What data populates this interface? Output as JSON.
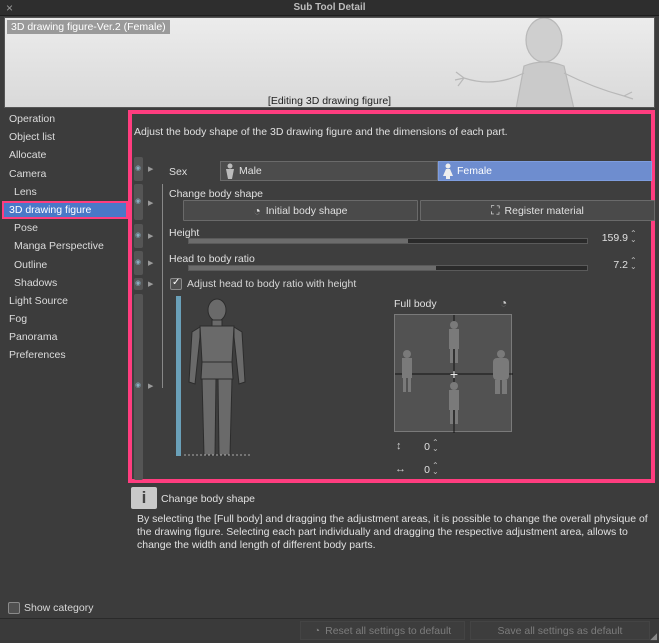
{
  "window": {
    "title": "Sub Tool Detail",
    "close_icon": "×"
  },
  "preview": {
    "tool_name": "3D drawing figure-Ver.2 (Female)",
    "status": "[Editing 3D drawing figure]"
  },
  "sidebar": {
    "items": [
      {
        "label": "Operation",
        "sub": false
      },
      {
        "label": "Object list",
        "sub": false
      },
      {
        "label": "Allocate",
        "sub": false
      },
      {
        "label": "Camera",
        "sub": false
      },
      {
        "label": "Lens",
        "sub": true
      },
      {
        "label": "3D drawing figure",
        "sub": false,
        "active": true
      },
      {
        "label": "Pose",
        "sub": true
      },
      {
        "label": "Manga Perspective",
        "sub": true
      },
      {
        "label": "Outline",
        "sub": true
      },
      {
        "label": "Shadows",
        "sub": true
      },
      {
        "label": "Light Source",
        "sub": false
      },
      {
        "label": "Fog",
        "sub": false
      },
      {
        "label": "Panorama",
        "sub": false
      },
      {
        "label": "Preferences",
        "sub": false
      }
    ],
    "show_category_label": "Show category"
  },
  "main": {
    "description": "Adjust the body shape of the 3D drawing figure and the dimensions of each part.",
    "sex": {
      "label": "Sex",
      "male": "Male",
      "female": "Female",
      "selected": "Female"
    },
    "change_body_shape": {
      "label": "Change body shape",
      "initial_button": "Initial body shape",
      "register_button": "Register material"
    },
    "height": {
      "label": "Height",
      "value": "159.9",
      "fraction": 0.55
    },
    "head_ratio": {
      "label": "Head to body ratio",
      "value": "7.2",
      "fraction": 0.62
    },
    "adjust_checkbox": {
      "label": "Adjust head to body ratio with height",
      "checked": true
    },
    "full_body": {
      "label": "Full body",
      "vertical_value": "0",
      "horizontal_value": "0"
    }
  },
  "info": {
    "icon": "i",
    "title": "Change body shape",
    "text": "By selecting the [Full body] and dragging the adjustment areas, it is possible to change the overall physique of the drawing figure. Selecting each part individually and dragging the respective adjustment area, allows to change the width and length of different body parts."
  },
  "footer": {
    "reset_label": "Reset all settings to default",
    "save_label": "Save all settings as default"
  },
  "colors": {
    "accent": "#4a78c8",
    "highlight": "#ff3d7f",
    "selected_segment": "#6e8dcf"
  }
}
